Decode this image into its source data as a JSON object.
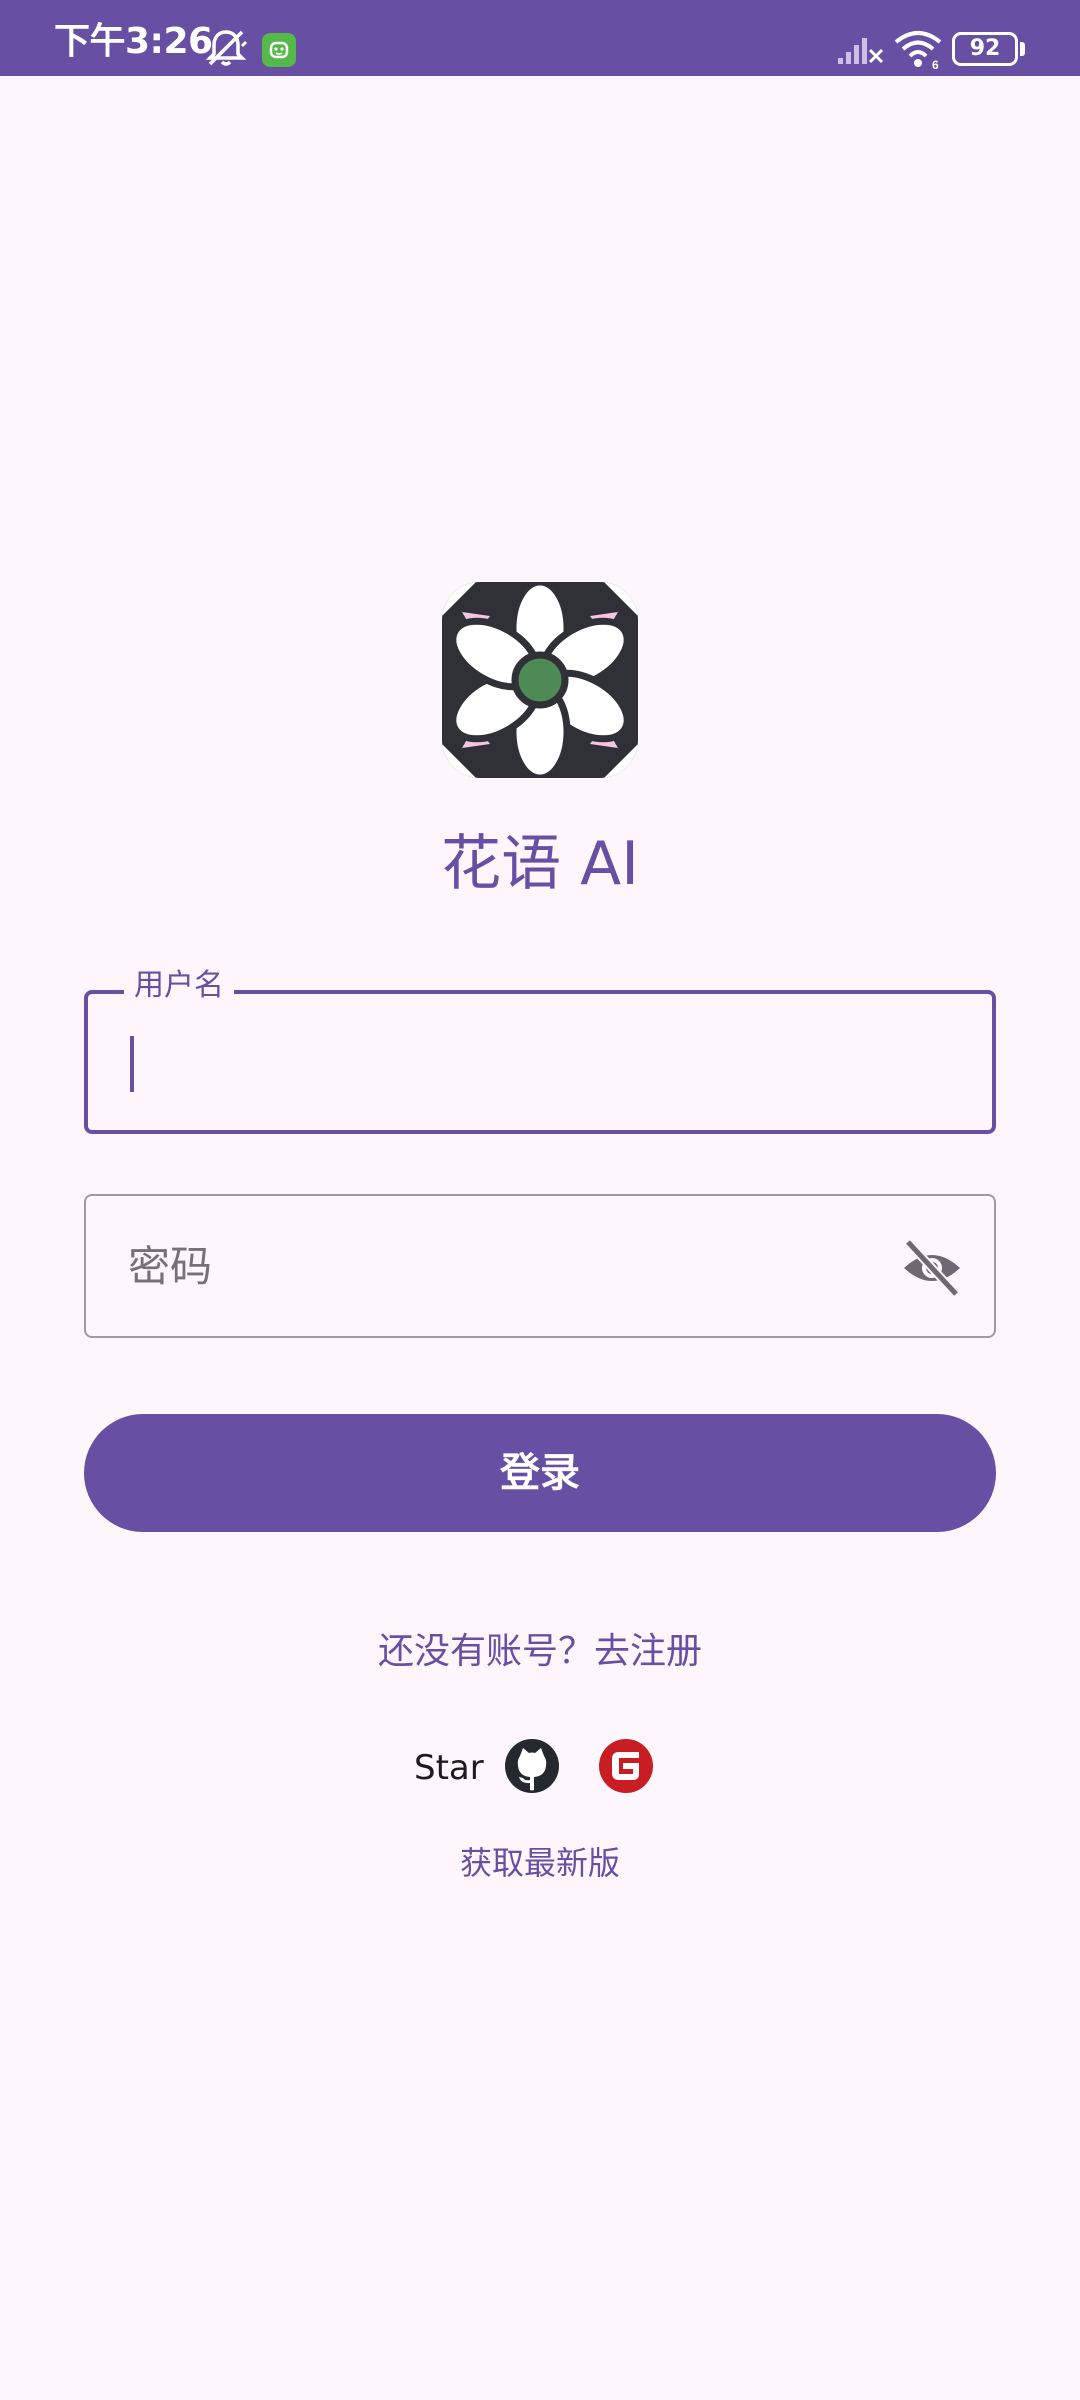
{
  "status_bar": {
    "time": "下午3:26",
    "battery_level": "92",
    "icons": [
      "bell-muted-icon",
      "app-notification-icon",
      "cellular-signal-icon",
      "wifi-icon",
      "battery-icon"
    ]
  },
  "app": {
    "logo": "flower-logo",
    "title": "花语 AI"
  },
  "form": {
    "username": {
      "label": "用户名",
      "value": ""
    },
    "password": {
      "placeholder": "密码",
      "value": "",
      "toggle_icon": "eye-off-icon"
    },
    "login_label": "登录"
  },
  "links": {
    "register": "还没有账号？去注册",
    "star_label": "Star",
    "star_icons": [
      "github-icon",
      "gitee-icon"
    ],
    "latest_version": "获取最新版"
  },
  "colors": {
    "primary": "#6750a4",
    "background": "#fdf7fc",
    "outline": "#9e9aa3",
    "gitee_red": "#c71d23",
    "logo_center": "#4e8a56",
    "logo_accent": "#f5c6dd"
  }
}
